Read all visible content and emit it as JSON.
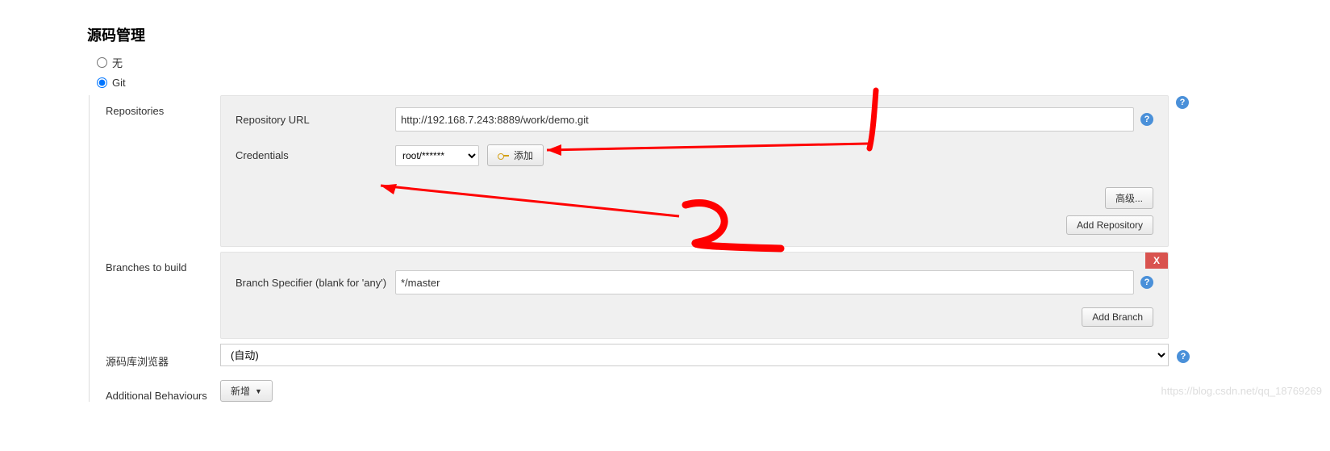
{
  "section": {
    "title": "源码管理"
  },
  "scm_options": {
    "none": {
      "label": "无",
      "checked": false
    },
    "git": {
      "label": "Git",
      "checked": true
    }
  },
  "repositories": {
    "side_label": "Repositories",
    "url_label": "Repository URL",
    "url_value": "http://192.168.7.243:8889/work/demo.git",
    "cred_label": "Credentials",
    "cred_selected": "root/******",
    "add_cred_label": "添加",
    "advanced_label": "高级...",
    "add_repo_label": "Add Repository"
  },
  "branches": {
    "side_label": "Branches to build",
    "spec_label": "Branch Specifier (blank for 'any')",
    "spec_value": "*/master",
    "add_branch_label": "Add Branch",
    "delete_label": "X"
  },
  "browser": {
    "side_label": "源码库浏览器",
    "selected": "(自动)"
  },
  "behaviours": {
    "side_label": "Additional Behaviours",
    "add_label": "新增"
  },
  "help_char": "?",
  "watermark": "https://blog.csdn.net/qq_18769269"
}
